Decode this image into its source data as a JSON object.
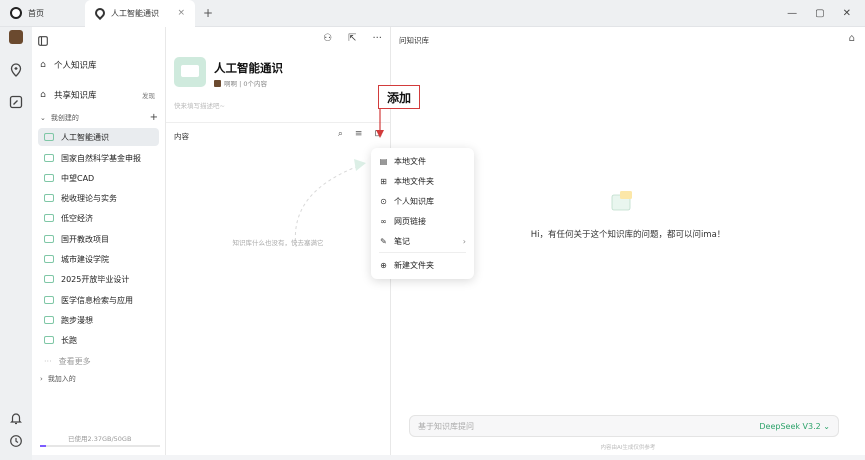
{
  "tabs": [
    {
      "label": "首页"
    },
    {
      "label": "人工智能通识",
      "close": "×"
    }
  ],
  "new_tab": "+",
  "window_controls": [
    "—",
    "▢",
    "✕"
  ],
  "sidebar": {
    "personal_kb": "个人知识库",
    "shared_kb": "共享知识库",
    "shared_badge": "发现",
    "my_created": "我创建的",
    "add": "+",
    "items": [
      {
        "label": "人工智能通识",
        "selected": true
      },
      {
        "label": "国家自然科学基金申报"
      },
      {
        "label": "中望CAD"
      },
      {
        "label": "税收理论与实务"
      },
      {
        "label": "低空经济"
      },
      {
        "label": "国开教改项目"
      },
      {
        "label": "城市建设学院"
      },
      {
        "label": "2025开放毕业设计"
      },
      {
        "label": "医学信息检索与应用"
      },
      {
        "label": "跑步漫想"
      },
      {
        "label": "长跑"
      }
    ],
    "more": "查看更多",
    "joined": "我加入的",
    "storage": "已使用2.37GB/50GB",
    "storage_fraction": 0.047
  },
  "middle": {
    "title": "人工智能通识",
    "meta": "啊啊 | 0个内容",
    "desc_placeholder": "快来填写描述吧~",
    "content_label": "内容",
    "empty_hint": "知识库什么也没有，快去塞满它"
  },
  "callout": "添加",
  "menu": {
    "items": [
      {
        "icon": "file-icon",
        "label": "本地文件"
      },
      {
        "icon": "folder-upload-icon",
        "label": "本地文件夹"
      },
      {
        "icon": "location-icon",
        "label": "个人知识库"
      },
      {
        "icon": "link-icon",
        "label": "网页链接"
      },
      {
        "icon": "note-icon",
        "label": "笔记",
        "submenu": "›"
      },
      {
        "icon": "new-folder-icon",
        "label": "新建文件夹"
      }
    ]
  },
  "right": {
    "title": "问知识库",
    "greeting": "Hi，有任何关于这个知识库的问题，都可以问ima！",
    "input_placeholder": "基于知识库提问",
    "model": "DeepSeek V3.2 ⌄",
    "disclaimer": "内容由AI生成仅供参考"
  },
  "colors": {
    "accent_green": "#2ea36b",
    "callout_red": "#d23b3b",
    "storage_purple": "#7c5cff"
  }
}
